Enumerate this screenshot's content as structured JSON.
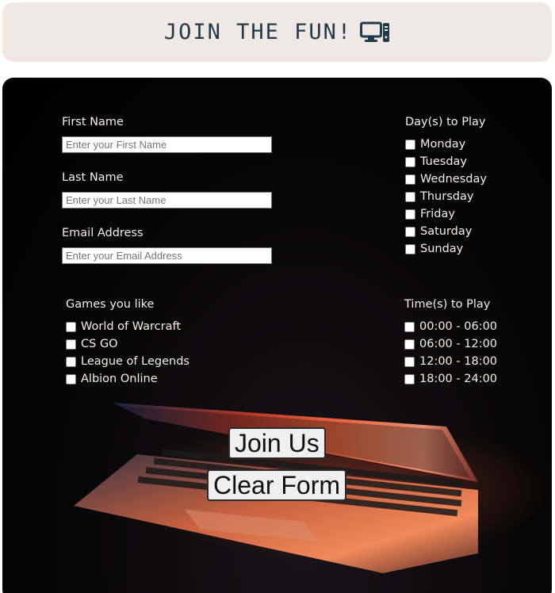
{
  "header": {
    "title": "JOIN THE FUN!",
    "icon": "desktop-computer-icon"
  },
  "form": {
    "first_name": {
      "label": "First Name",
      "placeholder": "Enter your First Name"
    },
    "last_name": {
      "label": "Last Name",
      "placeholder": "Enter your Last Name"
    },
    "email": {
      "label": "Email Address",
      "placeholder": "Enter your Email Address"
    },
    "days": {
      "label": "Day(s) to Play",
      "options": [
        "Monday",
        "Tuesday",
        "Wednesday",
        "Thursday",
        "Friday",
        "Saturday",
        "Sunday"
      ]
    },
    "games": {
      "label": "Games you like",
      "options": [
        "World of Warcraft",
        "CS GO",
        "League of Legends",
        "Albion Online"
      ]
    },
    "times": {
      "label": "Time(s) to Play",
      "options": [
        "00:00 - 06:00",
        "06:00 - 12:00",
        "12:00 - 18:00",
        "18:00 - 24:00"
      ]
    },
    "join_button": "Join Us",
    "clear_button": "Clear Form"
  },
  "colors": {
    "header_bg": "#f0e9e3",
    "header_text": "#1f3a4a",
    "panel_bg": "#000000",
    "label_text": "#f4efe8"
  }
}
